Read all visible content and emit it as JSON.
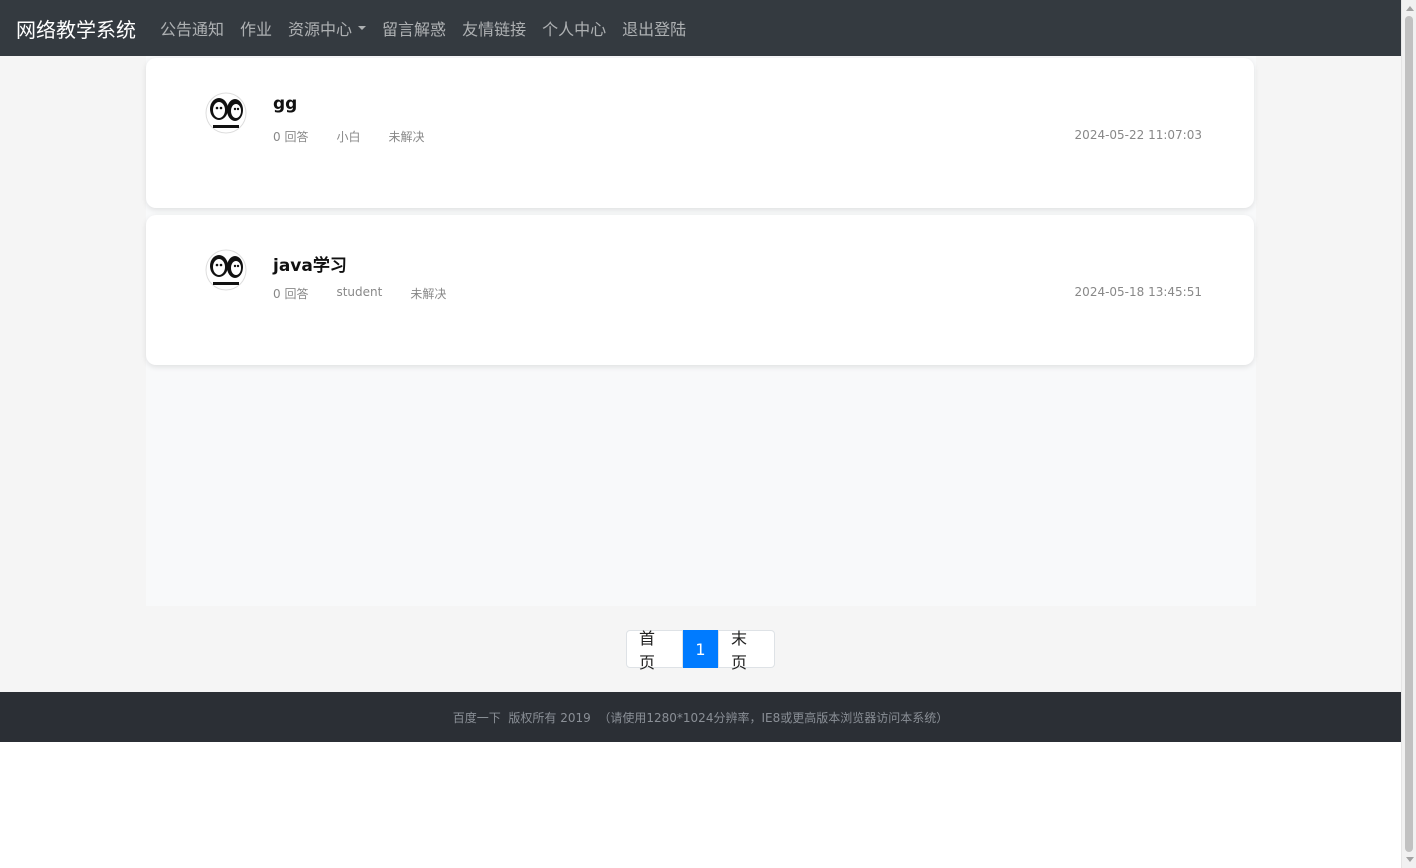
{
  "navbar": {
    "brand": "网络教学系统",
    "links": [
      "公告通知",
      "作业",
      "资源中心",
      "留言解惑",
      "友情链接",
      "个人中心",
      "退出登陆"
    ]
  },
  "questions": [
    {
      "title": "gg",
      "answers": "0 回答",
      "author": "小白",
      "status": "未解决",
      "time": "2024-05-22 11:07:03"
    },
    {
      "title": "java学习",
      "answers": "0 回答",
      "author": "student",
      "status": "未解决",
      "time": "2024-05-18 13:45:51"
    }
  ],
  "pagination": {
    "first": "首页",
    "current": "1",
    "last": "末页"
  },
  "footer": {
    "text": "百度一下  版权所有 2019  （请使用1280*1024分辨率，IE8或更高版本浏览器访问本系统）"
  },
  "colors": {
    "navbar_bg": "#343a40",
    "active_page": "#007bff",
    "footer_bg": "#2b2f35"
  }
}
